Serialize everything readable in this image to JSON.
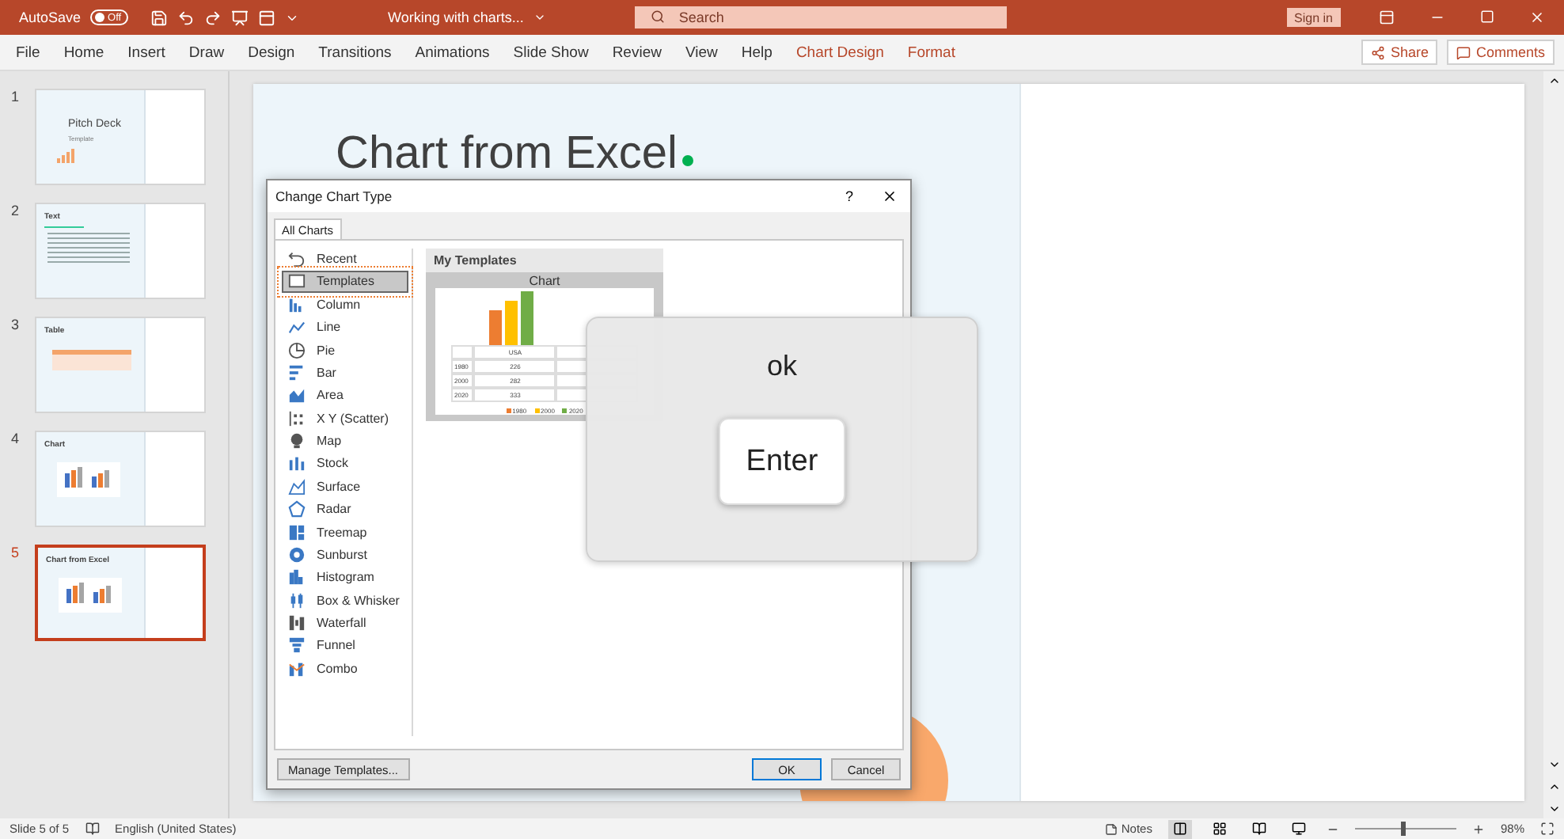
{
  "title_bar": {
    "autosave_label": "AutoSave",
    "autosave_toggle": {
      "label": "Off",
      "on": false
    },
    "document_title": "Working with charts...",
    "search": {
      "placeholder": "Search"
    },
    "sign_in": "Sign in"
  },
  "ribbon_tabs": [
    {
      "label": "File",
      "kind": "standard"
    },
    {
      "label": "Home",
      "kind": "standard"
    },
    {
      "label": "Insert",
      "kind": "standard"
    },
    {
      "label": "Draw",
      "kind": "standard"
    },
    {
      "label": "Design",
      "kind": "standard"
    },
    {
      "label": "Transitions",
      "kind": "standard"
    },
    {
      "label": "Animations",
      "kind": "standard"
    },
    {
      "label": "Slide Show",
      "kind": "standard"
    },
    {
      "label": "Review",
      "kind": "standard"
    },
    {
      "label": "View",
      "kind": "standard"
    },
    {
      "label": "Help",
      "kind": "standard"
    },
    {
      "label": "Chart Design",
      "kind": "contextual"
    },
    {
      "label": "Format",
      "kind": "contextual"
    }
  ],
  "ribbon_actions": [
    {
      "label": "Share",
      "kind": "share"
    },
    {
      "label": "Comments",
      "kind": "comments"
    }
  ],
  "slides": [
    {
      "number": "1",
      "kind": "title",
      "title": "Pitch Deck",
      "subtitle": "Template",
      "selected": false
    },
    {
      "number": "2",
      "kind": "text",
      "title": "Text",
      "selected": false
    },
    {
      "number": "3",
      "kind": "table",
      "title": "Table",
      "selected": false
    },
    {
      "number": "4",
      "kind": "chart",
      "title": "Chart",
      "selected": false
    },
    {
      "number": "5",
      "kind": "chart",
      "title": "Chart from Excel",
      "selected": true
    }
  ],
  "slide": {
    "title": "Chart from Excel"
  },
  "dialog": {
    "title": "Change Chart Type",
    "help": "?",
    "tabs": [
      {
        "label": "All Charts",
        "selected": true
      }
    ],
    "chart_types": [
      {
        "label": "Recent",
        "selected": false
      },
      {
        "label": "Templates",
        "selected": true
      },
      {
        "label": "Column",
        "selected": false
      },
      {
        "label": "Line",
        "selected": false
      },
      {
        "label": "Pie",
        "selected": false
      },
      {
        "label": "Bar",
        "selected": false
      },
      {
        "label": "Area",
        "selected": false
      },
      {
        "label": "X Y (Scatter)",
        "selected": false
      },
      {
        "label": "Map",
        "selected": false
      },
      {
        "label": "Stock",
        "selected": false
      },
      {
        "label": "Surface",
        "selected": false
      },
      {
        "label": "Radar",
        "selected": false
      },
      {
        "label": "Treemap",
        "selected": false
      },
      {
        "label": "Sunburst",
        "selected": false
      },
      {
        "label": "Histogram",
        "selected": false
      },
      {
        "label": "Box & Whisker",
        "selected": false
      },
      {
        "label": "Waterfall",
        "selected": false
      },
      {
        "label": "Funnel",
        "selected": false
      },
      {
        "label": "Combo",
        "selected": false
      }
    ],
    "section_title": "My Templates",
    "template": {
      "title": "Chart",
      "legend": [
        {
          "label": "1980",
          "color": "#ed7d31"
        },
        {
          "label": "2000",
          "color": "#ffc000"
        },
        {
          "label": "2020",
          "color": "#70ad47"
        }
      ],
      "table": {
        "columns": [
          "USA"
        ],
        "rows": [
          {
            "label": "1980",
            "cells": [
              "226"
            ]
          },
          {
            "label": "2000",
            "cells": [
              "282"
            ]
          },
          {
            "label": "2020",
            "cells": [
              "333"
            ]
          }
        ]
      }
    },
    "manage_button": "Manage Templates...",
    "ok_button": "OK",
    "cancel_button": "Cancel"
  },
  "key_overlay": {
    "caption": "ok",
    "key": "Enter"
  },
  "status_bar": {
    "slide_info": "Slide 5 of 5",
    "language": "English (United States)",
    "notes": "Notes",
    "zoom": {
      "level": 0.46,
      "reading": "98%"
    }
  }
}
